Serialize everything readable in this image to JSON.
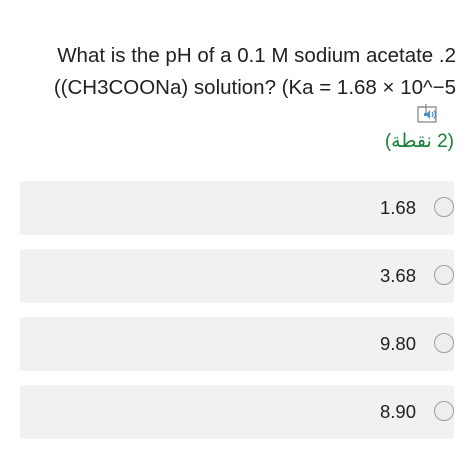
{
  "question": {
    "line1": "What is the pH of a 0.1 M sodium acetate .2",
    "line2": "((CH3COONa) solution? (Ka = 1.68 × 10^−5",
    "audio_icon": "speaker-icon",
    "points": "(2 نقطة)"
  },
  "options": [
    {
      "label": "1.68",
      "selected": false
    },
    {
      "label": "3.68",
      "selected": false
    },
    {
      "label": "9.80",
      "selected": false
    },
    {
      "label": "8.90",
      "selected": false
    }
  ],
  "colors": {
    "points": "#188038",
    "option_bg": "#f1f1f1",
    "radio_border": "#9e9e9e"
  }
}
